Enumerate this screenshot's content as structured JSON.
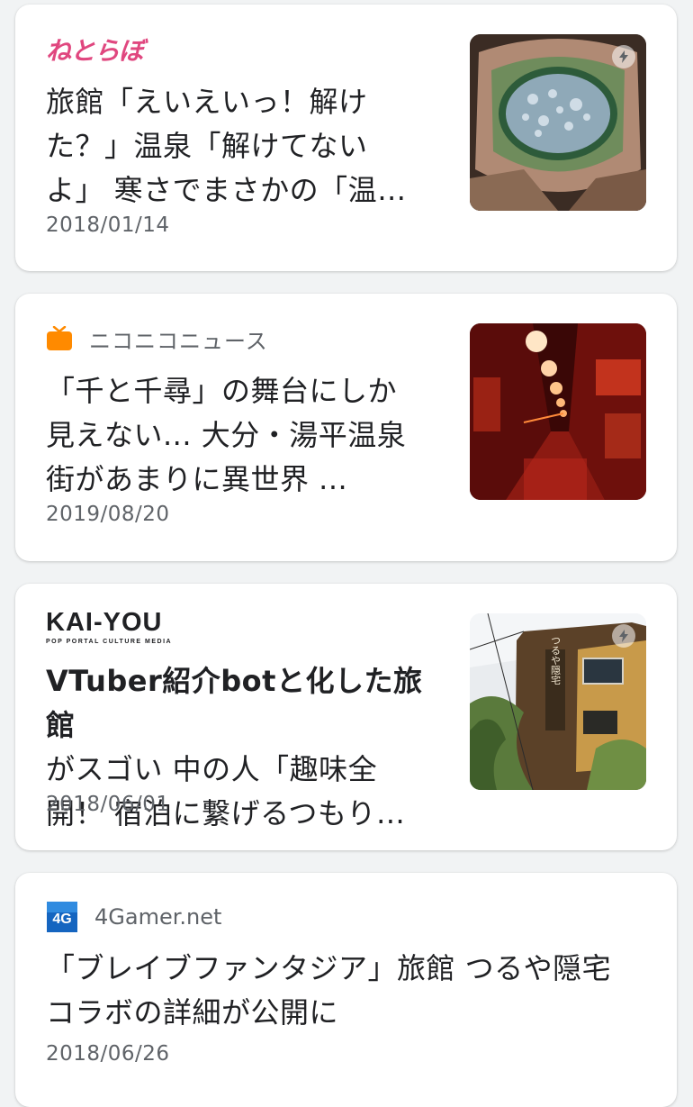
{
  "feed": {
    "items": [
      {
        "source": {
          "logo_text": "ねとらぼ",
          "logo_color": "#e0477f"
        },
        "headline": "旅館「えいえいっ！解けた？」温泉「解けてないよ」 寒さでまさかの「温…",
        "headline_lines": [
          "旅館「えいえいっ！解け",
          "た？」温泉「解けてない",
          "よ」 寒さでまさかの「温…"
        ],
        "date": "2018/01/14",
        "thumbnail": {
          "subject": "frozen hot spring tub",
          "amp_icon": "lightning-icon"
        }
      },
      {
        "source": {
          "name": "ニコニコニュース",
          "icon": "tv-icon",
          "icon_color": "#ff8a00"
        },
        "headline": "「千と千尋」の舞台にしか見えない... 大分・湯平温泉街があまりに異世界 ...",
        "headline_lines": [
          "「千と千尋」の舞台にしか",
          "見えない... 大分・湯平温泉",
          "街があまりに異世界 ..."
        ],
        "date": "2019/08/20",
        "thumbnail": {
          "subject": "red lantern alley at night"
        }
      },
      {
        "source": {
          "logo_text": "KAI-YOU",
          "logo_subtext": "POP PORTAL CULTURE MEDIA"
        },
        "headline": "VTuber紹介botと化した旅館がスゴい 中の人「趣味全開！ 宿泊に繋げるつもり…",
        "headline_lines": [
          "VTuber紹介botと化した旅館",
          "がスゴい 中の人「趣味全",
          "開！ 宿泊に繋げるつもり…"
        ],
        "date": "2018/06/01",
        "thumbnail": {
          "subject": "ryokan building exterior",
          "sign_text": "つるや隠宅",
          "amp_icon": "lightning-icon"
        }
      },
      {
        "source": {
          "name": "4Gamer.net",
          "icon_text": "4G",
          "icon_color": "#1565c0"
        },
        "headline": "「ブレイブファンタジア」旅館 つるや隠宅コラボの詳細が公開に",
        "headline_lines": [
          "「ブレイブファンタジア」旅館 つるや隠宅",
          "コラボの詳細が公開に"
        ],
        "date": "2018/06/26"
      }
    ]
  }
}
